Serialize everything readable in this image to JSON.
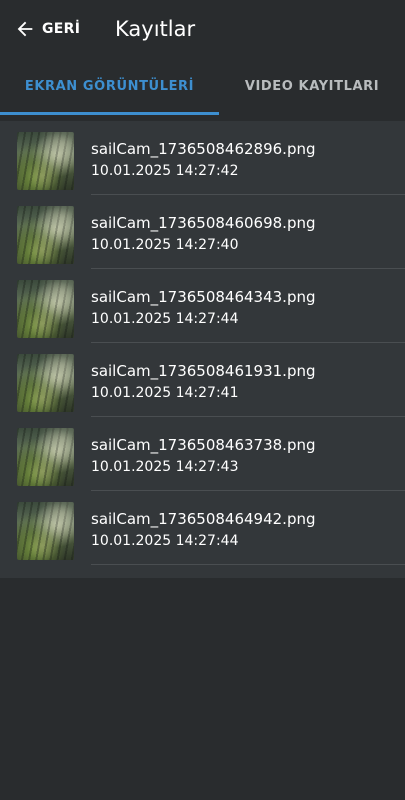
{
  "header": {
    "back_label": "GERİ",
    "title": "Kayıtlar"
  },
  "tabs": [
    {
      "label": "EKRAN GÖRÜNTÜLERİ",
      "active": true
    },
    {
      "label": "VIDEO KAYITLARI",
      "active": false
    }
  ],
  "colors": {
    "background": "#292c2e",
    "list_background": "#33373a",
    "accent": "#3d8fd0",
    "inactive_tab": "#b9bcbe"
  },
  "items": [
    {
      "name": "sailCam_1736508462896.png",
      "date": "10.01.2025 14:27:42",
      "icon": "image-thumbnail"
    },
    {
      "name": "sailCam_1736508460698.png",
      "date": "10.01.2025 14:27:40",
      "icon": "image-thumbnail"
    },
    {
      "name": "sailCam_1736508464343.png",
      "date": "10.01.2025 14:27:44",
      "icon": "image-thumbnail"
    },
    {
      "name": "sailCam_1736508461931.png",
      "date": "10.01.2025 14:27:41",
      "icon": "image-thumbnail"
    },
    {
      "name": "sailCam_1736508463738.png",
      "date": "10.01.2025 14:27:43",
      "icon": "image-thumbnail"
    },
    {
      "name": "sailCam_1736508464942.png",
      "date": "10.01.2025 14:27:44",
      "icon": "image-thumbnail"
    }
  ]
}
